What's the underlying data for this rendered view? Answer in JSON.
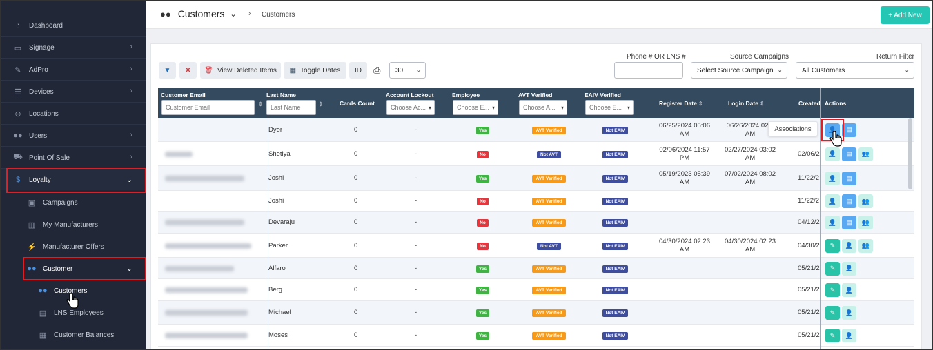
{
  "sidebar": {
    "items": [
      {
        "label": "Dashboard",
        "icon": "dashboard-icon"
      },
      {
        "label": "Signage",
        "icon": "monitor-icon"
      },
      {
        "label": "AdPro",
        "icon": "brush-icon"
      },
      {
        "label": "Devices",
        "icon": "server-icon"
      },
      {
        "label": "Locations",
        "icon": "pin-icon"
      },
      {
        "label": "Users",
        "icon": "users-icon"
      },
      {
        "label": "Point Of Sale",
        "icon": "cart-icon"
      },
      {
        "label": "Loyalty",
        "icon": "dollar-icon"
      }
    ],
    "loyalty_sub": [
      {
        "label": "Campaigns",
        "icon": "gift-icon"
      },
      {
        "label": "My Manufacturers",
        "icon": "factory-icon"
      },
      {
        "label": "Manufacturer Offers",
        "icon": "offer-icon"
      },
      {
        "label": "Customer",
        "icon": "users-icon"
      }
    ],
    "customer_sub": [
      {
        "label": "Customers",
        "icon": "users-icon"
      },
      {
        "label": "LNS Employees",
        "icon": "id-icon"
      },
      {
        "label": "Customer Balances",
        "icon": "balance-icon"
      }
    ]
  },
  "header": {
    "title": "Customers",
    "breadcrumb": "Customers",
    "add_button": "+ Add New"
  },
  "toolbar": {
    "view_deleted": "View Deleted Items",
    "toggle_dates": "Toggle Dates",
    "id_label": "ID",
    "page_size": "30"
  },
  "filters": {
    "phone_label": "Phone # OR LNS #",
    "phone_value": "",
    "source_label": "Source Campaigns",
    "source_value": "Select Source Campaign",
    "return_label": "Return Filter",
    "return_value": "All Customers"
  },
  "table": {
    "headers": {
      "email": "Customer Email",
      "email_placeholder": "Customer Email",
      "last_name": "Last Name",
      "last_name_placeholder": "Last Name",
      "cards": "Cards Count",
      "lockout": "Account Lockout",
      "lockout_choose": "Choose Ac...",
      "employee": "Employee",
      "employee_choose": "Choose E...",
      "avt": "AVT Verified",
      "avt_choose": "Choose A...",
      "eaiv": "EAIV Verified",
      "eaiv_choose": "Choose E...",
      "register": "Register Date",
      "login": "Login Date",
      "created": "Created",
      "actions": "Actions"
    },
    "rows": [
      {
        "name": "Dyer",
        "cards": "0",
        "lock": "-",
        "emp": "Yes",
        "avt": "AVT Verified",
        "eaiv": "Not EAIV",
        "reg1": "06/25/2024 05:06",
        "reg2": "AM",
        "log1": "06/26/2024 02:2",
        "log2": "AM",
        "created": ""
      },
      {
        "name": "Shetiya",
        "cards": "0",
        "lock": "-",
        "emp": "No",
        "avt": "Not AVT",
        "eaiv": "Not EAIV",
        "reg1": "02/06/2024 11:57",
        "reg2": "PM",
        "log1": "02/27/2024 03:02",
        "log2": "AM",
        "created": "02/06/2"
      },
      {
        "name": "Joshi",
        "cards": "0",
        "lock": "-",
        "emp": "Yes",
        "avt": "AVT Verified",
        "eaiv": "Not EAIV",
        "reg1": "05/19/2023 05:39",
        "reg2": "AM",
        "log1": "07/02/2024 08:02",
        "log2": "AM",
        "created": "11/22/2"
      },
      {
        "name": "Joshi",
        "cards": "0",
        "lock": "-",
        "emp": "No",
        "avt": "AVT Verified",
        "eaiv": "Not EAIV",
        "reg1": "",
        "reg2": "",
        "log1": "",
        "log2": "",
        "created": "11/22/2"
      },
      {
        "name": "Devaraju",
        "cards": "0",
        "lock": "-",
        "emp": "No",
        "avt": "AVT Verified",
        "eaiv": "Not EAIV",
        "reg1": "",
        "reg2": "",
        "log1": "",
        "log2": "",
        "created": "04/12/2"
      },
      {
        "name": "Parker",
        "cards": "0",
        "lock": "-",
        "emp": "No",
        "avt": "Not AVT",
        "eaiv": "Not EAIV",
        "reg1": "04/30/2024 02:23",
        "reg2": "AM",
        "log1": "04/30/2024 02:23",
        "log2": "AM",
        "created": "04/30/2"
      },
      {
        "name": "Alfaro",
        "cards": "0",
        "lock": "-",
        "emp": "Yes",
        "avt": "AVT Verified",
        "eaiv": "Not EAIV",
        "reg1": "",
        "reg2": "",
        "log1": "",
        "log2": "",
        "created": "05/21/2"
      },
      {
        "name": "Berg",
        "cards": "0",
        "lock": "-",
        "emp": "Yes",
        "avt": "AVT Verified",
        "eaiv": "Not EAIV",
        "reg1": "",
        "reg2": "",
        "log1": "",
        "log2": "",
        "created": "05/21/2"
      },
      {
        "name": "Michael",
        "cards": "0",
        "lock": "-",
        "emp": "Yes",
        "avt": "AVT Verified",
        "eaiv": "Not EAIV",
        "reg1": "",
        "reg2": "",
        "log1": "",
        "log2": "",
        "created": "05/21/2"
      },
      {
        "name": "Moses",
        "cards": "0",
        "lock": "-",
        "emp": "Yes",
        "avt": "AVT Verified",
        "eaiv": "Not EAIV",
        "reg1": "",
        "reg2": "",
        "log1": "",
        "log2": "",
        "created": "05/21/2"
      }
    ]
  },
  "tooltip": "Associations"
}
